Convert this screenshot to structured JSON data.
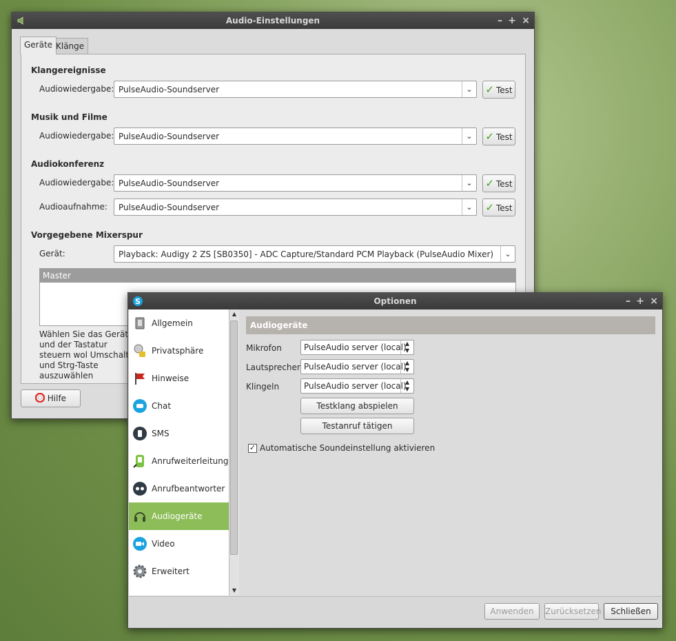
{
  "audio_window": {
    "title": "Audio-Einstellungen",
    "tabs": [
      {
        "label": "Geräte"
      },
      {
        "label": "Klänge"
      }
    ],
    "sections": {
      "klangereignisse": "Klangereignisse",
      "musik": "Musik und Filme",
      "konferenz": "Audiokonferenz",
      "mixer": "Vorgegebene Mixerspur"
    },
    "labels": {
      "audiowiedergabe": "Audiowiedergabe:",
      "audioaufnahme": "Audioaufnahme:",
      "geraet": "Gerät:"
    },
    "combo_value": "PulseAudio-Soundserver",
    "test_label": "Test",
    "mixer_device": "Playback: Audigy 2 ZS [SB0350] - ADC Capture/Standard PCM Playback (PulseAudio Mixer)",
    "mixer_track": "Master",
    "description": "Wählen Sie das Gerät und der Tastatur steuern wol Umschalt- und Strg-Taste auszuwählen",
    "help_label": "Hilfe"
  },
  "options_window": {
    "title": "Optionen",
    "nav": [
      {
        "label": "Allgemein",
        "icon": "general-icon"
      },
      {
        "label": "Privatsphäre",
        "icon": "privacy-icon"
      },
      {
        "label": "Hinweise",
        "icon": "flag-icon"
      },
      {
        "label": "Chat",
        "icon": "chat-icon"
      },
      {
        "label": "SMS",
        "icon": "sms-icon"
      },
      {
        "label": "Anrufweiterleitung",
        "icon": "call-forward-icon"
      },
      {
        "label": "Anrufbeantworter",
        "icon": "voicemail-icon"
      },
      {
        "label": "Audiogeräte",
        "icon": "headset-icon"
      },
      {
        "label": "Video",
        "icon": "video-icon"
      },
      {
        "label": "Erweitert",
        "icon": "gear-icon"
      }
    ],
    "selected": "Audiogeräte",
    "section_title": "Audiogeräte",
    "rows": [
      {
        "label": "Mikrofon",
        "value": "PulseAudio server (local)"
      },
      {
        "label": "Lautsprecher",
        "value": "PulseAudio server (local)"
      },
      {
        "label": "Klingeln",
        "value": "PulseAudio server (local)"
      }
    ],
    "test_sound": "Testklang abspielen",
    "test_call": "Testanruf tätigen",
    "auto_label": "Automatische Soundeinstellung aktivieren",
    "auto_checked": true,
    "buttons": {
      "apply": "Anwenden",
      "reset": "Zurücksetzen",
      "close": "Schließen"
    }
  },
  "colors": {
    "accent_green": "#8dbd58",
    "titlebar": "#3e3e3e"
  }
}
